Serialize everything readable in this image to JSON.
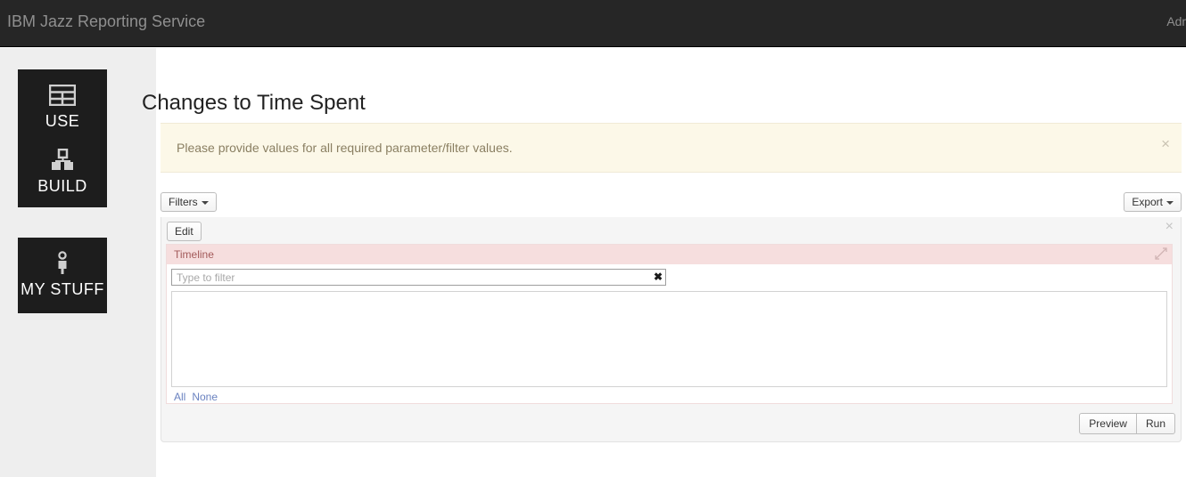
{
  "topbar": {
    "title": "IBM Jazz Reporting Service",
    "user_label": "Admin"
  },
  "rail": {
    "items": [
      {
        "label": "USE",
        "icon": "table-grid-icon"
      },
      {
        "label": "BUILD",
        "icon": "blocks-icon"
      },
      {
        "label": "MY STUFF",
        "icon": "person-icon"
      }
    ]
  },
  "page": {
    "title": "Changes to Time Spent"
  },
  "alert": {
    "message": "Please provide values for all required parameter/filter values.",
    "close_label": "×"
  },
  "toolbar": {
    "filters_label": "Filters",
    "export_label": "Export"
  },
  "filter_panel": {
    "edit_label": "Edit",
    "close_label": "×",
    "card": {
      "title": "Timeline",
      "filter_placeholder": "Type to filter",
      "filter_value": "",
      "clear_label": "✖",
      "list_items": [],
      "select_all_label": "All",
      "select_none_label": "None"
    },
    "preview_label": "Preview",
    "run_label": "Run"
  },
  "colors": {
    "topbar_bg": "#262626",
    "rail_bg": "#eeeeee",
    "tile_bg": "#1d1d1d",
    "alert_bg": "#fcf8e8",
    "alert_text": "#8a7f62",
    "card_header_bg": "#f6dede",
    "card_title_text": "#a35a5a",
    "link": "#6a82c0"
  }
}
